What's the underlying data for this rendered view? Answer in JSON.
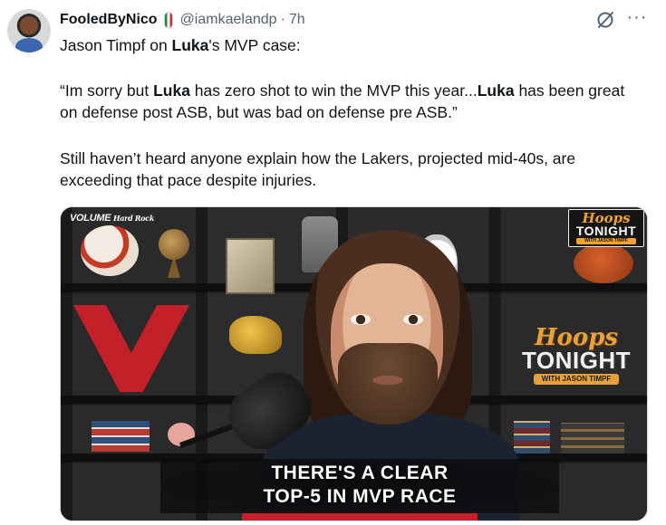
{
  "tweet": {
    "author": {
      "display_name": "FooledByNico",
      "flag": "flag-icon",
      "handle": "@iamkaelandp",
      "separator": "·",
      "time": "7h"
    },
    "actions": {
      "grok": "grok-icon",
      "more": "···"
    },
    "text": {
      "line1_a": "Jason Timpf on ",
      "line1_b": "Luka",
      "line1_c": "'s MVP case:",
      "quote_a": "“Im sorry but ",
      "quote_b": "Luka",
      "quote_c": " has zero shot to win the MVP this year...",
      "quote_d": "Luka",
      "quote_e": " has been great on defense post ASB, but was bad on defense pre ASB.”",
      "para3": "Still haven’t heard anyone explain how the Lakers, projected mid-40s, are exceeding that pace despite injuries."
    },
    "media": {
      "caption_line1": "THERE'S A CLEAR",
      "caption_line2": "TOP-5 IN MVP RACE",
      "show_logo": {
        "line1": "Hoops",
        "line2": "TONIGHT",
        "line3": "WITH JASON TIMPF"
      },
      "volume_logo": {
        "brand": "VOLUME",
        "sub": "Hard Rock"
      }
    }
  },
  "colors": {
    "text": "#0f1419",
    "secondary": "#536471",
    "accent_orange": "#e8a13a",
    "accent_red": "#c3202a"
  }
}
